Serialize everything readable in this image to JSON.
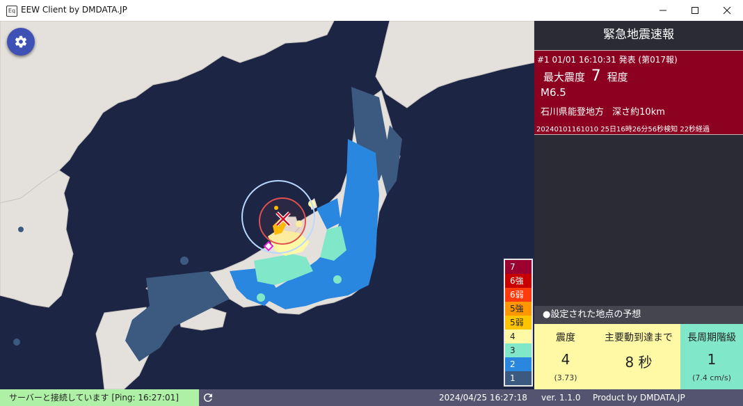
{
  "window": {
    "title": "EEW Client by DMDATA.JP",
    "icon": "app-icon",
    "icon_text": "Eq",
    "buttons": [
      "minimize-icon",
      "maximize-icon",
      "close-icon"
    ]
  },
  "map": {
    "settings_icon": "gear-icon",
    "epicenter_icon": "x-mark-icon",
    "observation_icon": "diamond-marker-icon",
    "colors": {
      "sea": "#1c2544",
      "land": "#e4e1dd",
      "p_wave": "#b8d8ff",
      "s_wave": "#e05050"
    }
  },
  "legend": [
    {
      "label": "7",
      "bg": "#9b0030",
      "fg": "#ffffff"
    },
    {
      "label": "6強",
      "bg": "#c80000",
      "fg": "#ffffff"
    },
    {
      "label": "6弱",
      "bg": "#ff3a0c",
      "fg": "#ffffff"
    },
    {
      "label": "5強",
      "bg": "#ff9800",
      "fg": "#222222"
    },
    {
      "label": "5弱",
      "bg": "#ffc400",
      "fg": "#222222"
    },
    {
      "label": "4",
      "bg": "#fff9a6",
      "fg": "#222222"
    },
    {
      "label": "3",
      "bg": "#80e8c8",
      "fg": "#222222"
    },
    {
      "label": "2",
      "bg": "#2a87e0",
      "fg": "#ffffff"
    },
    {
      "label": "1",
      "bg": "#3c5a80",
      "fg": "#ffffff"
    }
  ],
  "panel": {
    "title": "緊急地震速報",
    "eew": {
      "header": "#1  01/01 16:10:31 発表  (第017報)",
      "intensity_prefix": "最大震度",
      "intensity_value": "7",
      "intensity_suffix": "程度",
      "magnitude": "M6.5",
      "hypocenter": "石川県能登地方",
      "depth": "深さ約10km",
      "footer": "20240101161010  25日16時26分56秒検知  22秒経過",
      "bg": "#8c0020"
    },
    "forecast": {
      "heading": "●設定された地点の予想",
      "intensity_label": "震度",
      "intensity_value": "4",
      "intensity_sub": "(3.73)",
      "arrival_label": "主要動到達まで",
      "arrival_value": "8 秒",
      "lpgm_label": "長周期階級",
      "lpgm_value": "1",
      "lpgm_sub": "(7.4 cm/s)"
    }
  },
  "status": {
    "connection": "サーバーと接続しています [Ping: 16:27:01]",
    "reload_icon": "reload-icon",
    "datetime": "2024/04/25 16:27:18",
    "version": "ver. 1.1.0",
    "product": "Product by DMDATA.JP"
  }
}
